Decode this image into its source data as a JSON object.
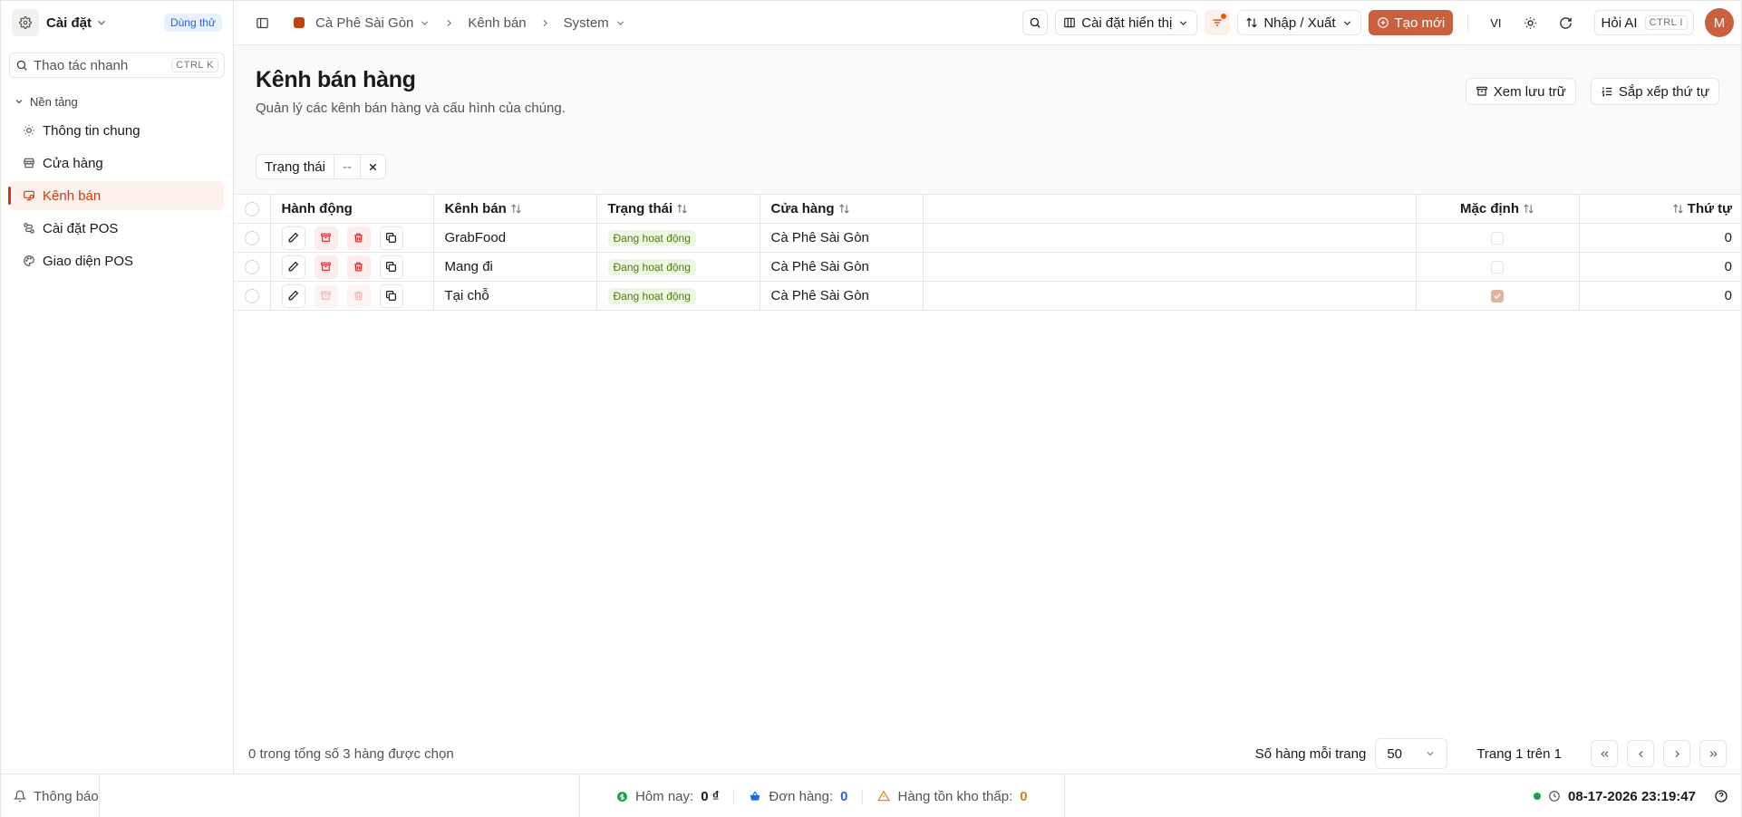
{
  "sidebar": {
    "title": "Cài đặt",
    "badge": "Dùng thử",
    "search_placeholder": "Thao tác nhanh",
    "search_kbd": "CTRL K",
    "group_label": "Nền tảng",
    "items": [
      {
        "label": "Thông tin chung",
        "icon": "sun-icon"
      },
      {
        "label": "Cửa hàng",
        "icon": "store-icon"
      },
      {
        "label": "Kênh bán",
        "icon": "channel-icon",
        "active": true
      },
      {
        "label": "Cài đặt POS",
        "icon": "route-icon"
      },
      {
        "label": "Giao diện POS",
        "icon": "palette-icon"
      }
    ]
  },
  "topbar": {
    "store_name": "Cà Phê Sài Gòn",
    "crumb_channel": "Kênh bán",
    "crumb_system": "System",
    "display_settings": "Cài đặt hiển thị",
    "import_export": "Nhập / Xuất",
    "create_new": "Tạo mới",
    "language": "VI",
    "ask_ai": "Hỏi AI",
    "ask_ai_kbd": "CTRL I",
    "avatar_initial": "M"
  },
  "page": {
    "title": "Kênh bán hàng",
    "subtitle": "Quản lý các kênh bán hàng và cấu hình của chúng.",
    "view_archive": "Xem lưu trữ",
    "sort_order": "Sắp xếp thứ tự",
    "filter_label": "Trạng thái",
    "filter_value": "--"
  },
  "table": {
    "columns": {
      "actions": "Hành động",
      "channel": "Kênh bán",
      "status": "Trạng thái",
      "store": "Cửa hàng",
      "default": "Mặc định",
      "order": "Thứ tự"
    },
    "rows": [
      {
        "channel": "GrabFood",
        "status": "Đang hoạt động",
        "store": "Cà Phê Sài Gòn",
        "is_default": false,
        "order": "0",
        "archive_enabled": true
      },
      {
        "channel": "Mang đi",
        "status": "Đang hoạt động",
        "store": "Cà Phê Sài Gòn",
        "is_default": false,
        "order": "0",
        "archive_enabled": true
      },
      {
        "channel": "Tại chỗ",
        "status": "Đang hoạt động",
        "store": "Cà Phê Sài Gòn",
        "is_default": true,
        "order": "0",
        "archive_enabled": false
      }
    ]
  },
  "footer": {
    "selected_text": "0 trong tổng số 3 hàng được chọn",
    "rows_per_page_label": "Số hàng mỗi trang",
    "rows_per_page_value": "50",
    "page_info": "Trang 1 trên 1"
  },
  "statusbar": {
    "notifications": "Thông báo",
    "today_label": "Hôm nay:",
    "today_value": "0 ₫",
    "orders_label": "Đơn hàng:",
    "orders_value": "0",
    "low_stock_label": "Hàng tồn kho thấp:",
    "low_stock_value": "0",
    "datetime": "08-17-2026 23:19:47"
  },
  "colors": {
    "accent": "#c9613f",
    "active_bg": "#fdf0ec",
    "status_green": "#4d7c0f",
    "danger": "#dc2626"
  }
}
